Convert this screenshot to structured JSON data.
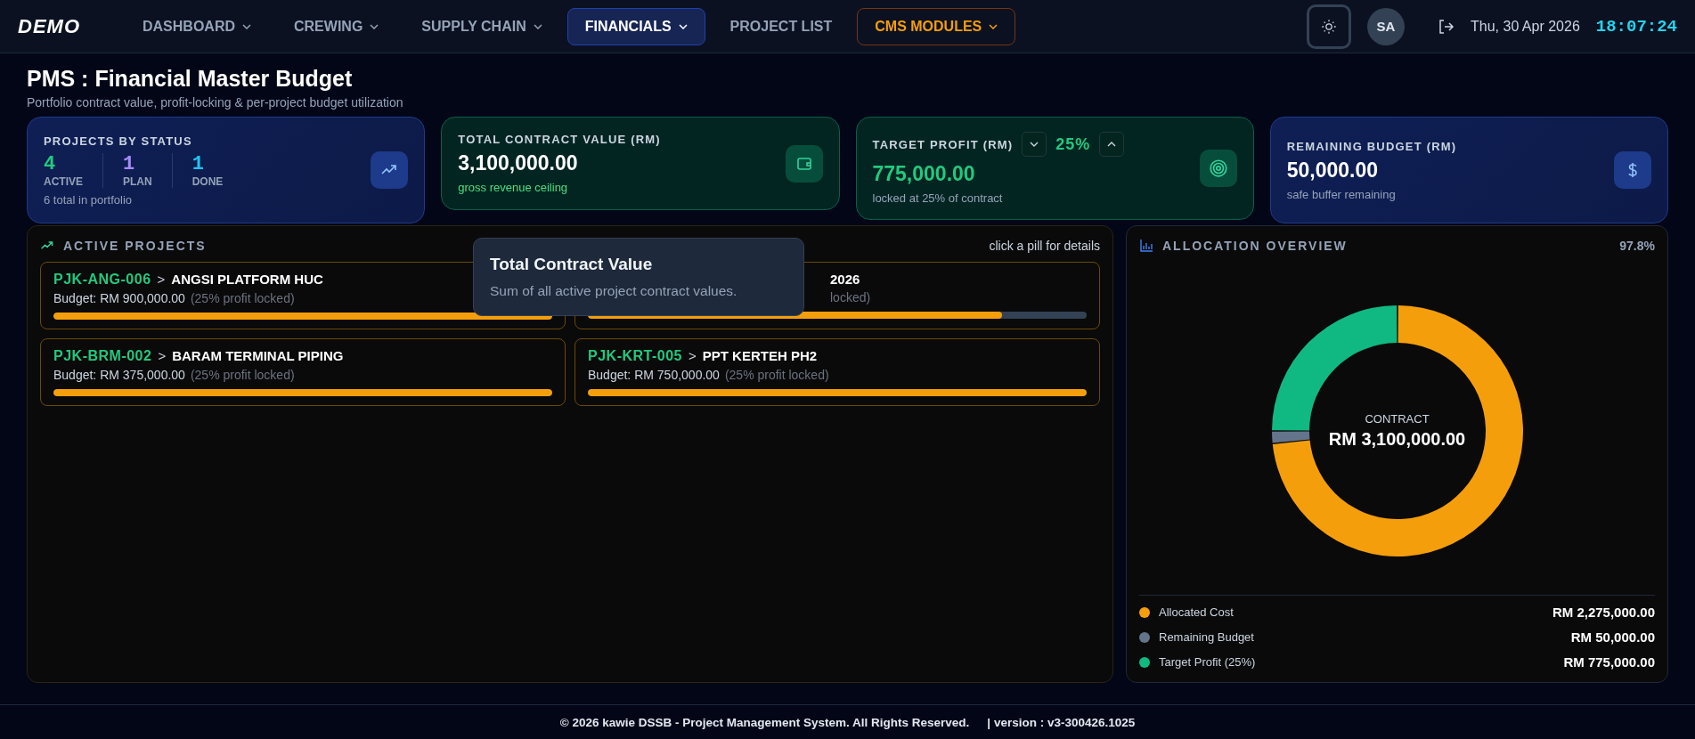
{
  "nav": {
    "logo": "DEMO",
    "items": [
      {
        "label": "DASHBOARD",
        "dropdown": true,
        "selected": false,
        "kind": "plain"
      },
      {
        "label": "CREWING",
        "dropdown": true,
        "selected": false,
        "kind": "plain"
      },
      {
        "label": "SUPPLY CHAIN",
        "dropdown": true,
        "selected": false,
        "kind": "plain"
      },
      {
        "label": "FINANCIALS",
        "dropdown": true,
        "selected": true,
        "kind": "plain"
      },
      {
        "label": "PROJECT LIST",
        "dropdown": false,
        "selected": false,
        "kind": "plain"
      },
      {
        "label": "CMS MODULES",
        "dropdown": true,
        "selected": false,
        "kind": "accent"
      }
    ],
    "avatar": "SA",
    "date": "Thu, 30 Apr 2026",
    "time": "18:07:24"
  },
  "header": {
    "title": "PMS : Financial Master Budget",
    "subtitle": "Portfolio contract value, profit-locking & per-project budget utilization"
  },
  "cards": [
    {
      "kind": "status",
      "label": "PROJECTS BY STATUS",
      "counts": [
        {
          "value": "4",
          "label": "ACTIVE",
          "color": "#22c97e"
        },
        {
          "value": "1",
          "label": "PLAN",
          "color": "#a78bfa"
        },
        {
          "value": "1",
          "label": "DONE",
          "color": "#22c3ee"
        }
      ],
      "note": "6 total in portfolio"
    },
    {
      "kind": "contract",
      "label": "TOTAL CONTRACT VALUE (RM)",
      "value": "3,100,000.00",
      "note": "gross revenue ceiling"
    },
    {
      "kind": "profit",
      "label": "TARGET PROFIT (RM)",
      "percent": "25%",
      "value": "775,000.00",
      "note": "locked at 25% of contract"
    },
    {
      "kind": "remaining",
      "label": "REMAINING BUDGET (RM)",
      "value": "50,000.00",
      "note": "safe buffer remaining"
    }
  ],
  "projects": {
    "title": "ACTIVE PROJECTS",
    "hint": "click a pill for details",
    "items": [
      {
        "kind": "full",
        "code": "PJK-ANG-006",
        "sep": ">",
        "name": "ANGSI PLATFORM HUC",
        "budget": "Budget: RM 900,000.00",
        "lock": "(25% profit locked)",
        "level": 1
      },
      {
        "kind": "covered",
        "name": "2026",
        "lock": "locked)",
        "level": 0.83
      },
      {
        "kind": "full",
        "code": "PJK-BRM-002",
        "sep": ">",
        "name": "BARAM TERMINAL PIPING",
        "budget": "Budget: RM 375,000.00",
        "lock": "(25% profit locked)",
        "level": 1
      },
      {
        "kind": "full",
        "code": "PJK-KRT-005",
        "sep": ">",
        "name": "PPT KERTEH PH2",
        "budget": "Budget: RM 750,000.00",
        "lock": "(25% profit locked)",
        "level": 1
      }
    ],
    "tooltip": {
      "title": "Total Contract Value",
      "text": "Sum of all active project contract values."
    }
  },
  "allocation": {
    "title": "ALLOCATION OVERVIEW",
    "percent": "97.8%",
    "center_label": "CONTRACT",
    "center_value": "RM 3,100,000.00",
    "chart_data": {
      "type": "donut",
      "categories": [
        "Allocated Cost",
        "Remaining Budget",
        "Target Profit (25%)"
      ],
      "values": [
        73.39,
        1.61,
        25
      ]
    },
    "legend": [
      {
        "value": "RM 2,275,000.00",
        "color": "#f59e0b"
      },
      {
        "value": "RM 50,000.00",
        "color": "#64748b"
      },
      {
        "value": "RM 775,000.00",
        "color": "#10b981"
      }
    ]
  },
  "footer": {
    "copyright": "© 2026 kawie DSSB - Project Management System. All Rights Reserved.",
    "version": "| version : v3-300426.1025"
  }
}
